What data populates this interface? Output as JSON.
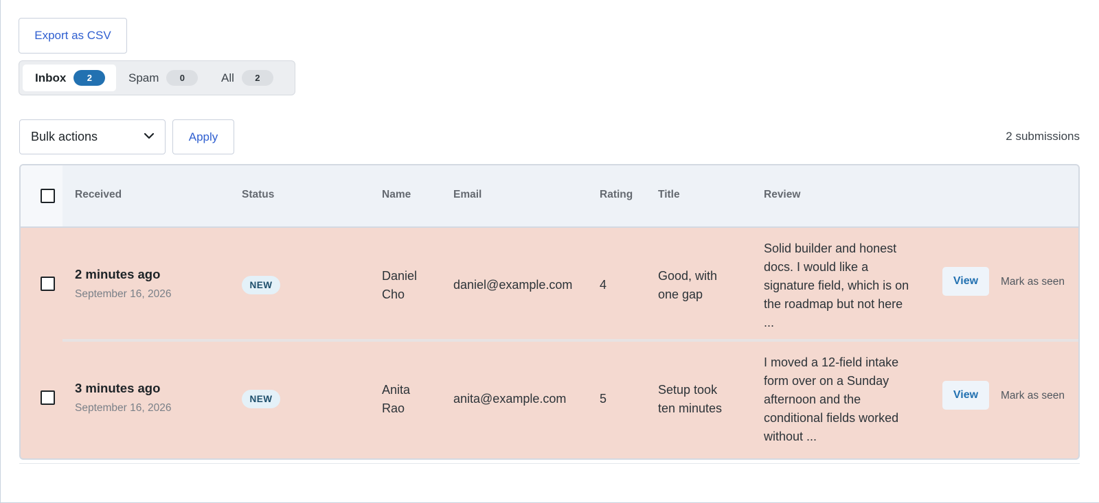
{
  "toolbar": {
    "export_label": "Export as CSV",
    "bulk_actions_label": "Bulk actions",
    "apply_label": "Apply",
    "submission_count_text": "2 submissions"
  },
  "tabs": [
    {
      "label": "Inbox",
      "count": "2",
      "active": true
    },
    {
      "label": "Spam",
      "count": "0",
      "active": false
    },
    {
      "label": "All",
      "count": "2",
      "active": false
    }
  ],
  "table": {
    "headers": [
      "Received",
      "Status",
      "Name",
      "Email",
      "Rating",
      "Title",
      "Review"
    ],
    "rows": [
      {
        "received": "2 minutes ago",
        "date": "September 16, 2026",
        "status": "NEW",
        "name_first": "Daniel",
        "name_last": "Cho",
        "email": "daniel@example.com",
        "rating": "4",
        "title_line1": "Good, with",
        "title_line2": "one gap",
        "review_lines": [
          "Solid builder and honest",
          "docs. I would like a",
          "signature field, which is on",
          "the roadmap but not here",
          "..."
        ],
        "view_label": "View",
        "seen_label": "Mark as seen"
      },
      {
        "received": "3 minutes ago",
        "date": "September 16, 2026",
        "status": "NEW",
        "name_first": "Anita",
        "name_last": "Rao",
        "email": "anita@example.com",
        "rating": "5",
        "title_line1": "Setup took",
        "title_line2": "ten minutes",
        "review_lines": [
          "I moved a 12-field intake",
          "form over on a Sunday",
          "afternoon and the",
          "conditional fields worked",
          "without ..."
        ],
        "view_label": "View",
        "seen_label": "Mark as seen"
      }
    ]
  },
  "colors": {
    "accent": "#2271b1",
    "link": "#2f5fd0",
    "unread_row_bg": "#f4d9d0",
    "header_bg": "#eef2f7"
  },
  "icons": {
    "bulk_dropdown": "chevron-down-icon"
  }
}
